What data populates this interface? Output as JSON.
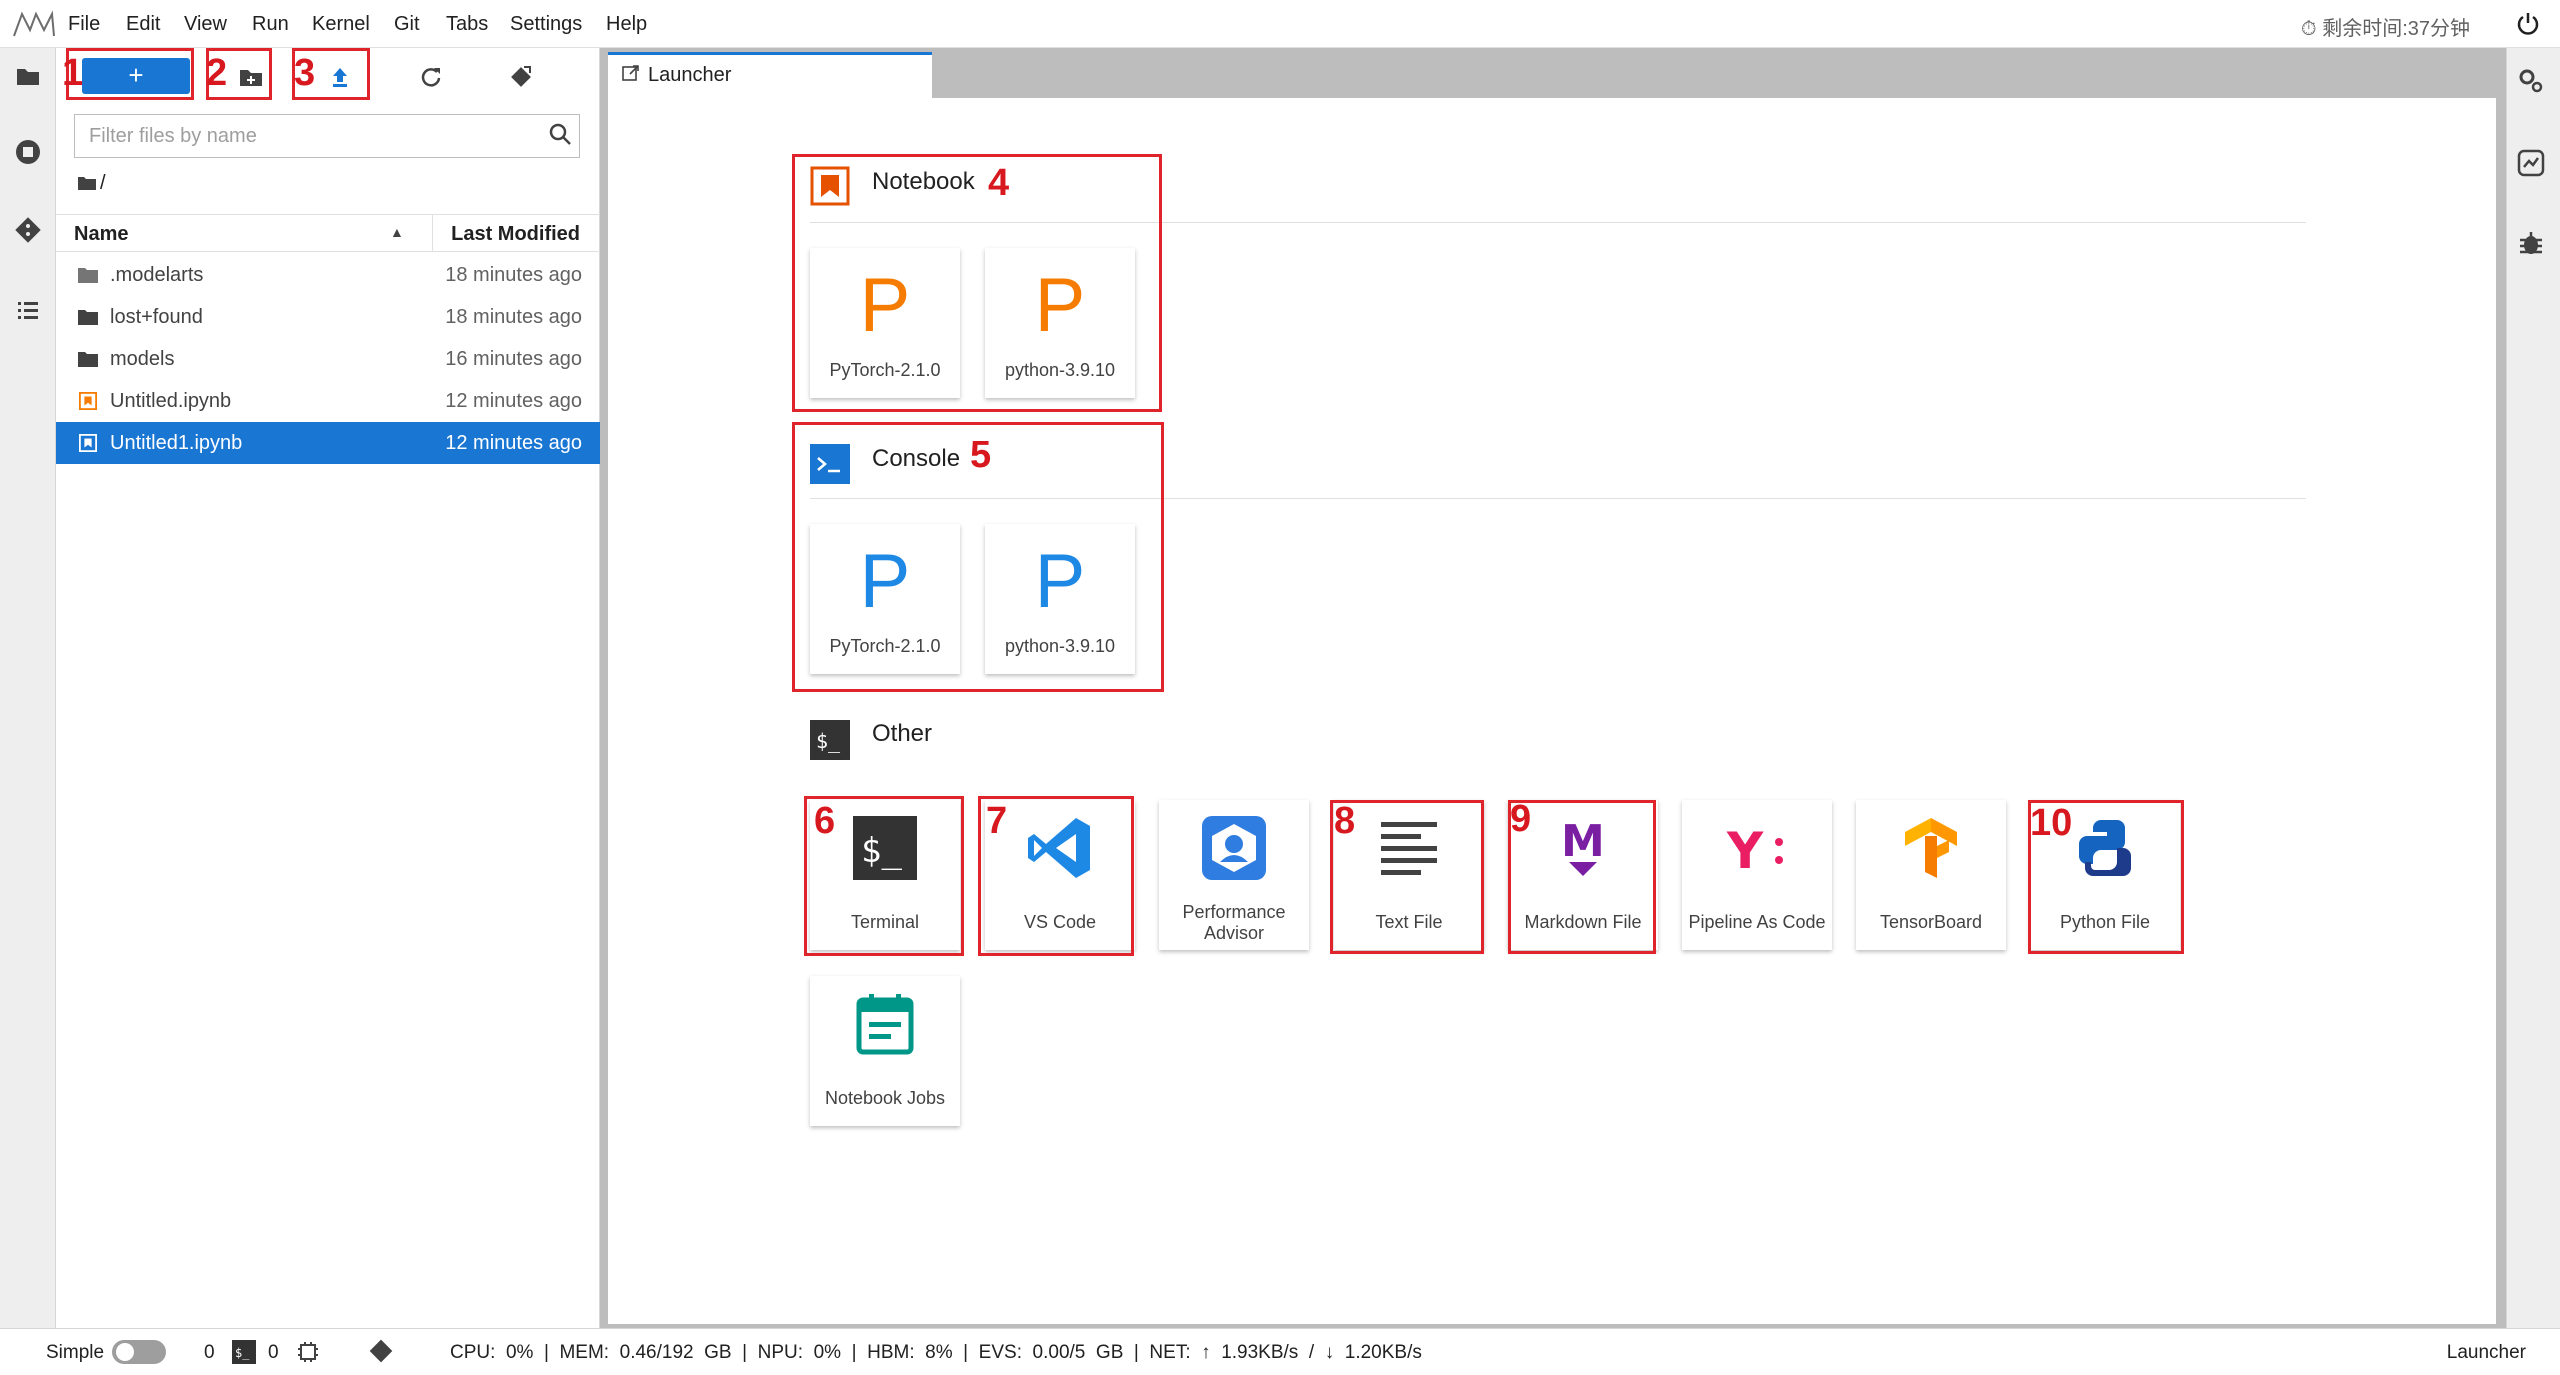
{
  "menubar": {
    "items": [
      "File",
      "Edit",
      "View",
      "Run",
      "Kernel",
      "Git",
      "Tabs",
      "Settings",
      "Help"
    ],
    "timer": "⏱ 剩余时间:37分钟"
  },
  "filebrowser": {
    "new_label": "+",
    "filter_placeholder": "Filter files by name",
    "breadcrumb": "/",
    "col_name": "Name",
    "col_modified": "Last Modified",
    "files": [
      {
        "name": ".modelarts",
        "modified": "18 minutes ago",
        "type": "folder"
      },
      {
        "name": "lost+found",
        "modified": "18 minutes ago",
        "type": "folder"
      },
      {
        "name": "models",
        "modified": "16 minutes ago",
        "type": "folder"
      },
      {
        "name": "Untitled.ipynb",
        "modified": "12 minutes ago",
        "type": "notebook"
      },
      {
        "name": "Untitled1.ipynb",
        "modified": "12 minutes ago",
        "type": "notebook",
        "selected": true
      }
    ]
  },
  "tab": {
    "label": "Launcher"
  },
  "launcher": {
    "notebook": {
      "title": "Notebook",
      "kernels": [
        "PyTorch-2.1.0",
        "python-3.9.10"
      ]
    },
    "console": {
      "title": "Console",
      "kernels": [
        "PyTorch-2.1.0",
        "python-3.9.10"
      ]
    },
    "other": {
      "title": "Other",
      "items": [
        "Terminal",
        "VS Code",
        "Performance Advisor",
        "Text File",
        "Markdown File",
        "Pipeline As Code",
        "TensorBoard",
        "Python File",
        "Notebook Jobs"
      ]
    }
  },
  "annotations": [
    "1",
    "2",
    "3",
    "4",
    "5",
    "6",
    "7",
    "8",
    "9",
    "10"
  ],
  "statusbar": {
    "mode": "Simple",
    "terminals": "0",
    "kernels": "0",
    "resources": "CPU:  0%  |  MEM:  0.46/192  GB  |  NPU:  0%  |  HBM:  8%  |  EVS:  0.00/5  GB  |  NET:  ↑  1.93KB/s  /  ↓  1.20KB/s",
    "current": "Launcher"
  },
  "colors": {
    "accent": "#1976d2",
    "notebook_orange": "#f57c00",
    "console_blue": "#1e88e5",
    "annotation_red": "#e0242b"
  }
}
